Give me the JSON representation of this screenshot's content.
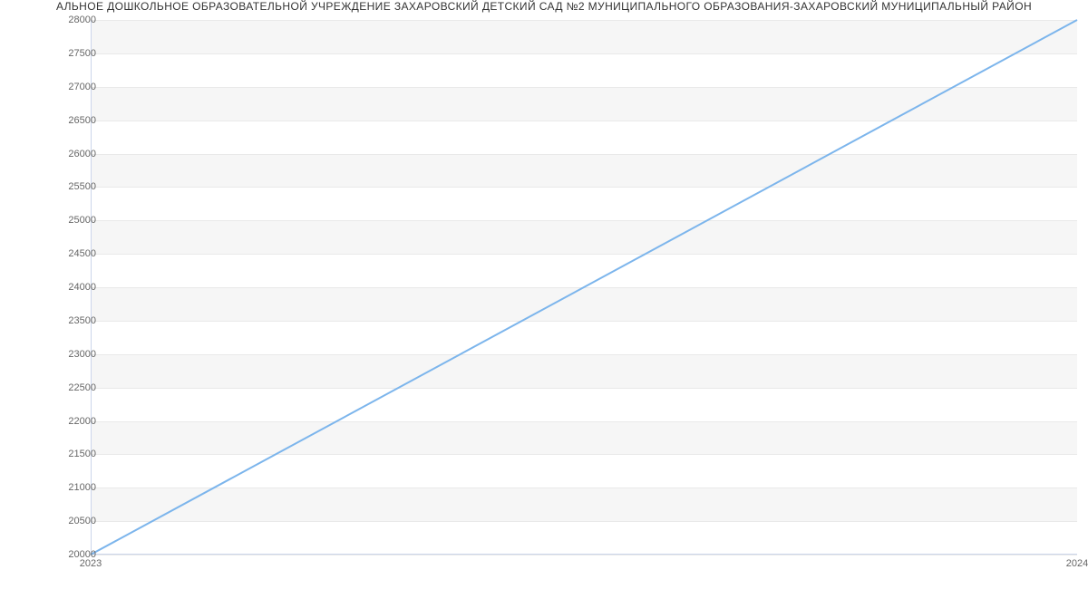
{
  "chart_data": {
    "type": "line",
    "title": "АЛЬНОЕ ДОШКОЛЬНОЕ ОБРАЗОВАТЕЛЬНОЙ УЧРЕЖДЕНИЕ ЗАХАРОВСКИЙ ДЕТСКИЙ САД №2 МУНИЦИПАЛЬНОГО ОБРАЗОВАНИЯ-ЗАХАРОВСКИЙ МУНИЦИПАЛЬНЫЙ РАЙОН",
    "x": [
      2023,
      2024
    ],
    "values": [
      20000,
      28000
    ],
    "xlabel": "",
    "ylabel": "",
    "xlim": [
      2023,
      2024
    ],
    "ylim": [
      20000,
      28000
    ],
    "y_ticks": [
      20000,
      20500,
      21000,
      21500,
      22000,
      22500,
      23000,
      23500,
      24000,
      24500,
      25000,
      25500,
      26000,
      26500,
      27000,
      27500,
      28000
    ],
    "x_ticks": [
      2023,
      2024
    ],
    "line_color": "#7cb5ec"
  }
}
